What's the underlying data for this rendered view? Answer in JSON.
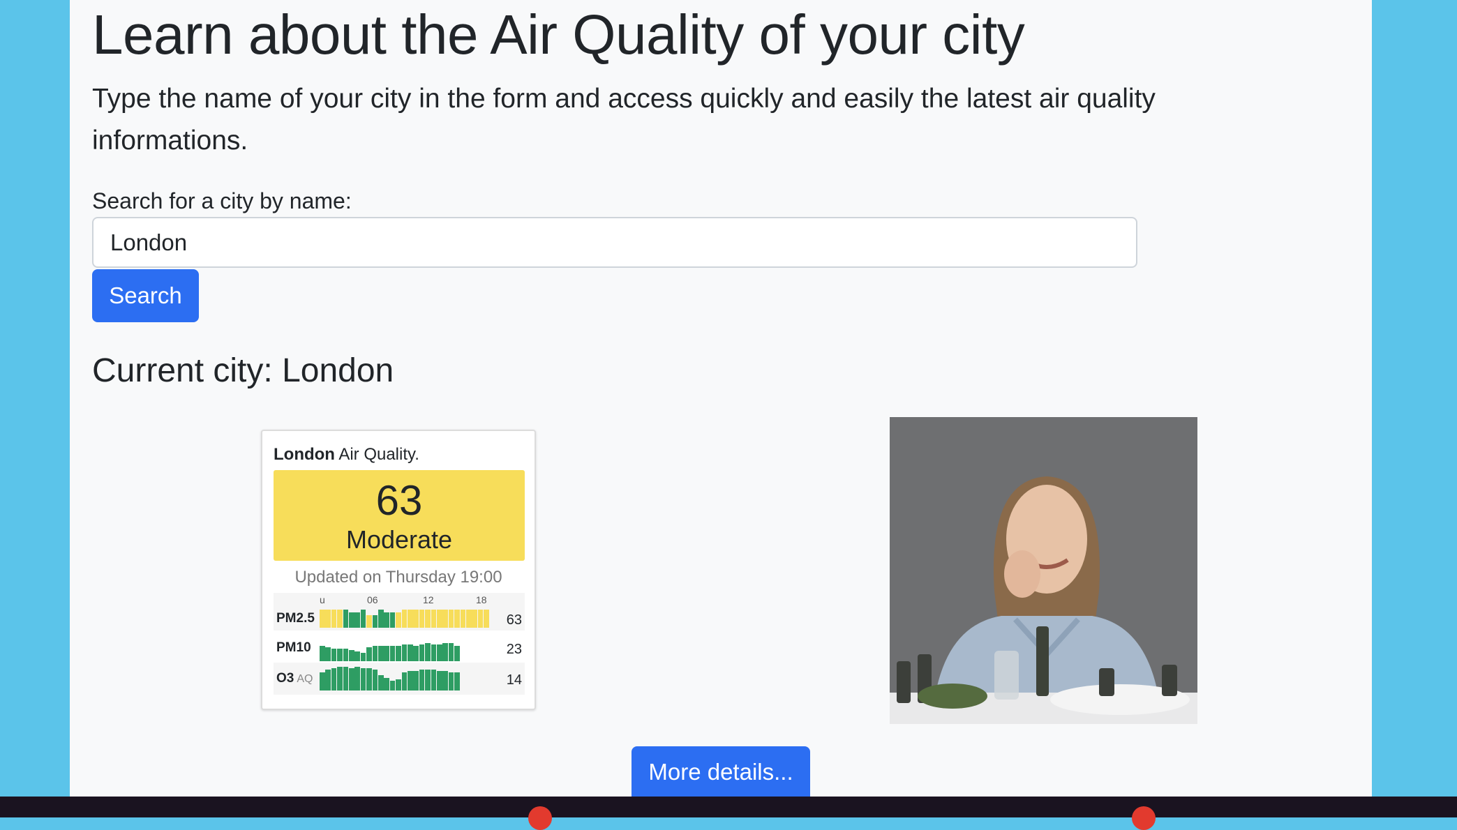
{
  "header": {
    "title": "Learn about the Air Quality of your city",
    "lead": "Type the name of your city in the form and access quickly and easily the latest air quality informations."
  },
  "search": {
    "label": "Search for a city by name:",
    "value": "London",
    "button_label": "Search"
  },
  "current_city": "Current city: London",
  "widget": {
    "city": "London",
    "title_suffix": "Air Quality.",
    "aqi": "63",
    "level": "Moderate",
    "updated": "Updated on Thursday 19:00",
    "hour_ticks": [
      "u",
      "06",
      "12",
      "18"
    ],
    "pollutants": [
      {
        "name": "PM2.5",
        "value": "63",
        "sub": ""
      },
      {
        "name": "PM10",
        "value": "23",
        "sub": ""
      },
      {
        "name": "O3",
        "value": "14",
        "sub": "AQ"
      }
    ],
    "colors": {
      "moderate": "#f7dd5a",
      "good": "#2e9d63"
    }
  },
  "photo": {
    "icon": "person-photo"
  },
  "more_details_label": "More details...",
  "colors": {
    "background": "#5bc4ea",
    "primary": "#2c6ef2"
  }
}
